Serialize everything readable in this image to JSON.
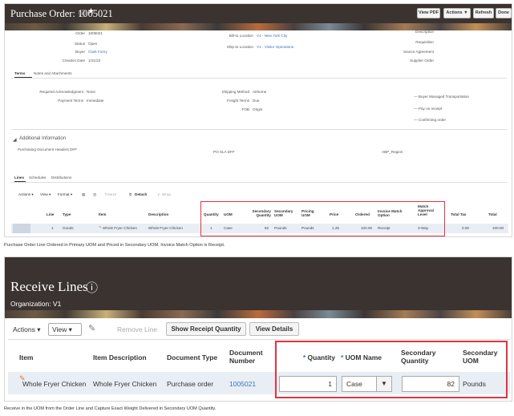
{
  "top": {
    "title": "Purchase Order: 1005021",
    "buttons": {
      "view_pdf": "View PDF",
      "actions": "Actions ▼",
      "refresh": "Refresh",
      "done": "Done"
    },
    "fields": {
      "order_label": "Order",
      "order_value": "1005021",
      "status_label": "Status",
      "status_value": "Open",
      "buyer_label": "Buyer",
      "buyer_value": "Clark Furey",
      "creation_label": "Creation Date",
      "creation_value": "1/21/22",
      "bill_label": "Bill-to Location",
      "bill_value": "V1 - New York City",
      "ship_label": "Ship-to Location",
      "ship_value": "V1 - Visitor Operations",
      "description_label": "Description",
      "requisition_label": "Requisition",
      "source_label": "Source Agreement",
      "supplier_order_label": "Supplier Order"
    },
    "tabs": [
      "Terms",
      "Notes and Attachments"
    ],
    "terms": {
      "ack_label": "Required Acknowledgment",
      "ack_value": "None",
      "payment_label": "Payment Terms",
      "payment_value": "Immediate",
      "shipping_label": "Shipping Method",
      "shipping_value": "Airborne",
      "freight_label": "Freight Terms",
      "freight_value": "Due",
      "fob_label": "FOB",
      "fob_value": "Origin",
      "flags": [
        "Buyer Managed Transportation",
        "Pay on receipt",
        "Confirming order"
      ]
    },
    "additional": {
      "title": "Additional Information",
      "field1_label": "Purchasing Document Headers DFF",
      "field2_label": "PO SLA DFF",
      "field3_label": "ABP_Region"
    },
    "line_tabs": [
      "Lines",
      "Schedules",
      "Distributions"
    ],
    "toolbar": {
      "actions": "Actions ▾",
      "view": "View ▾",
      "format": "Format ▾",
      "freeze": "Freeze",
      "detach": "Detach",
      "wrap": "Wrap"
    },
    "columns": [
      "Line",
      "Type",
      "Item",
      "Description",
      "Quantity",
      "UOM",
      "Secondary Quantity",
      "Secondary UOM",
      "Pricing UOM",
      "Price",
      "Ordered",
      "Invoice Match Option",
      "Match Approval Level",
      "Total Tax",
      "Total"
    ],
    "row": [
      "1",
      "Goods",
      "Whole Fryer Chicken",
      "Whole Fryer Chicken",
      "1",
      "Case",
      "82",
      "Pounds",
      "Pounds",
      "1.25",
      "100.00",
      "Receipt",
      "3-Way",
      "0.00",
      "100.00"
    ],
    "caption": "Purchase Order Line Ordered in Primary UOM and Priced in Secondary UOM. Invoice Match Option is Receipt."
  },
  "bottom": {
    "title": "Receive Lines",
    "organization": "Organization: V1",
    "toolbar": {
      "actions": "Actions ▾",
      "view": "View ▾",
      "remove": "Remove Line",
      "show_qty": "Show Receipt Quantity",
      "view_details": "View Details"
    },
    "columns": [
      "Item",
      "Item Description",
      "Document Type",
      "Document Number",
      "Quantity",
      "UOM Name",
      "Secondary Quantity",
      "Secondary UOM"
    ],
    "row": {
      "item": "Whole Fryer Chicken",
      "description": "Whole Fryer Chicken",
      "doc_type": "Purchase order",
      "doc_number": "1005021",
      "quantity": "1",
      "uom": "Case",
      "sec_qty": "82",
      "sec_uom": "Pounds"
    },
    "caption": "Receive in the UOM from the Order Line and Capture Exact Weight Delivered in Secondary UOM Quantity."
  },
  "colors": {
    "accent_red": "#e53340",
    "link": "#3b72b9",
    "header_bg": "#3a3330"
  }
}
